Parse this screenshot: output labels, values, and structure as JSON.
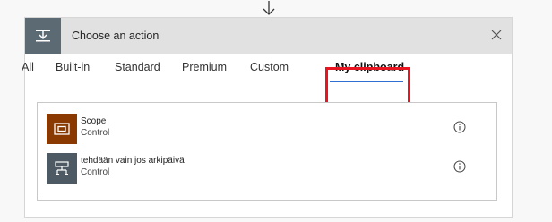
{
  "header": {
    "title": "Choose an action",
    "icon_color": "#5c6a74"
  },
  "tabs": [
    {
      "label": "All"
    },
    {
      "label": "Built-in"
    },
    {
      "label": "Standard"
    },
    {
      "label": "Premium"
    },
    {
      "label": "Custom"
    },
    {
      "label": "My clipboard",
      "active": true
    }
  ],
  "highlight_color": "#e8141f",
  "actions": [
    {
      "title": "Scope",
      "subtitle": "Control",
      "icon": "scope-icon",
      "icon_color": "#8a3a00"
    },
    {
      "title": "tehdään vain jos arkipäivä",
      "subtitle": "Control",
      "icon": "condition-icon",
      "icon_color": "#4e5a63"
    }
  ]
}
